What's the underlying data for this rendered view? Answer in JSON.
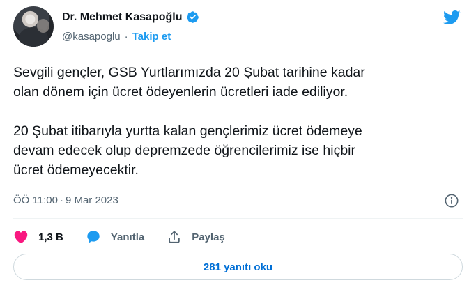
{
  "author": {
    "name": "Dr. Mehmet Kasapoğlu",
    "handle": "@kasapoglu",
    "separator": "·",
    "follow_label": "Takip et",
    "verified_icon": "verified-badge-icon"
  },
  "tweet": {
    "text": "Sevgili gençler, GSB Yurtlarımızda 20 Şubat tarihine kadar\nolan dönem için ücret ödeyenlerin ücretleri iade ediliyor.\n\n20 Şubat itibarıyla yurtta kalan gençlerimiz ücret ödemeye\ndevam edecek olup depremzede öğrencilerimiz ise hiçbir\nücret ödemeyecektir.",
    "time": "ÖÖ 11:00",
    "date_separator": "·",
    "date": "9 Mar 2023"
  },
  "actions": {
    "like_count": "1,3 B",
    "reply_label": "Yanıtla",
    "share_label": "Paylaş"
  },
  "footer": {
    "replies_button": "281 yanıtı oku"
  },
  "colors": {
    "accent": "#1d9bf0",
    "like": "#f91880",
    "secondary_text": "#536471",
    "link_button_text": "#006fd6"
  }
}
